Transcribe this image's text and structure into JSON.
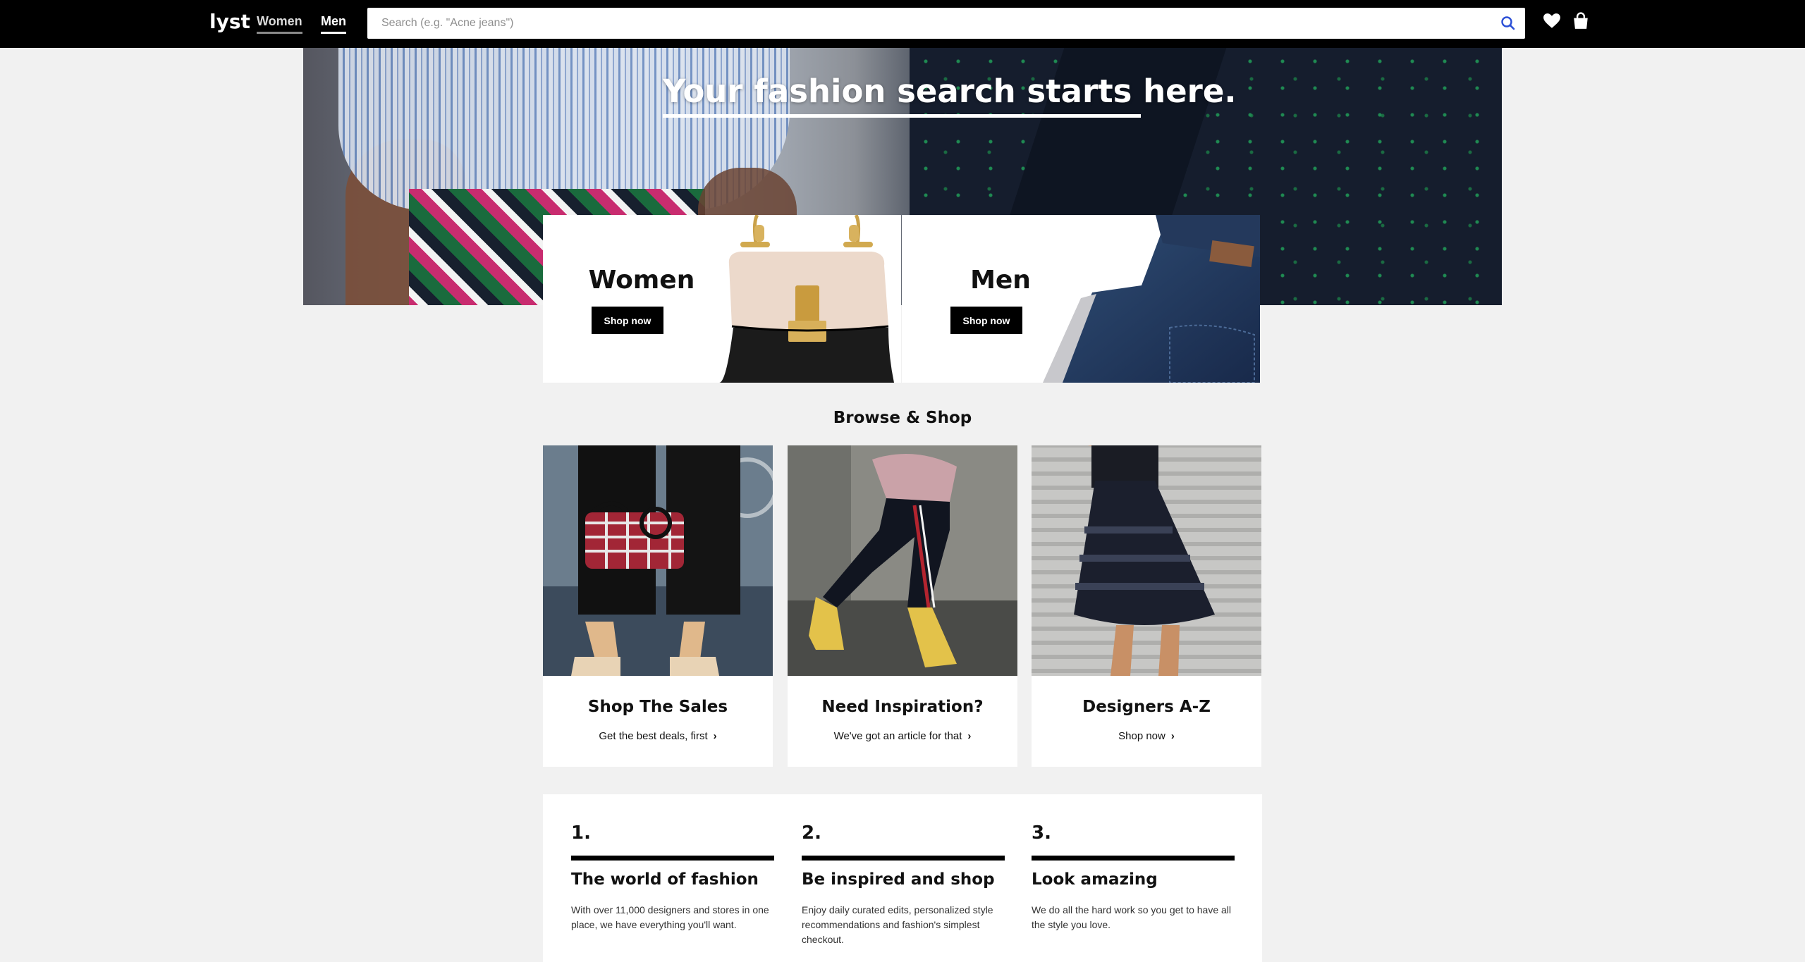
{
  "header": {
    "logo": "lyst",
    "nav": {
      "women": "Women",
      "men": "Men"
    },
    "search_placeholder": "Search (e.g. \"Acne jeans\")",
    "icons": [
      "search-icon",
      "heart-icon",
      "shopping-bag-icon"
    ],
    "active_nav": "Men"
  },
  "hero": {
    "title": "Your fashion search starts here."
  },
  "gender_cards": {
    "women": {
      "title": "Women",
      "button": "Shop now"
    },
    "men": {
      "title": "Men",
      "button": "Shop now"
    }
  },
  "browse": {
    "title": "Browse & Shop",
    "cards": [
      {
        "title": "Shop The Sales",
        "subtitle": "Get the best deals, first"
      },
      {
        "title": "Need Inspiration?",
        "subtitle": "We've got an article for that"
      },
      {
        "title": "Designers A-Z",
        "subtitle": "Shop now"
      }
    ]
  },
  "steps": [
    {
      "number": "1.",
      "title": "The world of fashion",
      "text": "With over 11,000 designers and stores in one place, we have everything you'll want."
    },
    {
      "number": "2.",
      "title": "Be inspired and shop",
      "text": "Enjoy daily curated edits, personalized style recommendations and fashion's simplest checkout."
    },
    {
      "number": "3.",
      "title": "Look amazing",
      "text": "We do all the hard work so you get to have all the style you love."
    }
  ],
  "colors": {
    "header_bg": "#000000",
    "page_bg": "#f1f1f1",
    "accent_search": "#2b4fd6"
  }
}
